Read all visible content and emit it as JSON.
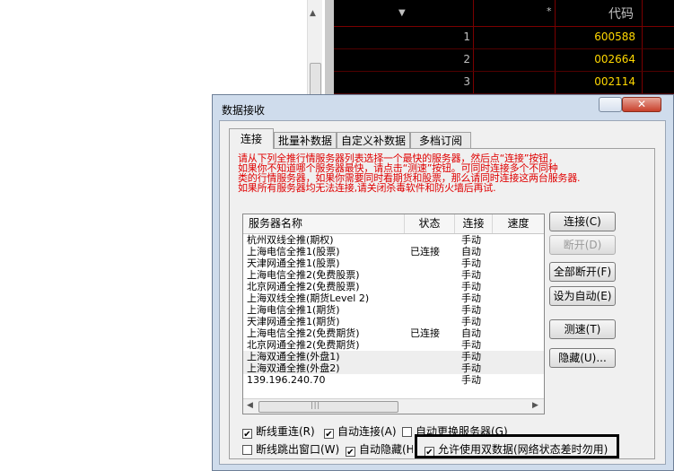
{
  "grid": {
    "header": {
      "star": "*",
      "code": "代码"
    },
    "rows": [
      {
        "num": "1",
        "code": "600588"
      },
      {
        "num": "2",
        "code": "002664"
      },
      {
        "num": "3",
        "code": "002114"
      }
    ]
  },
  "dialog": {
    "title": "数据接收",
    "close_label": "✕",
    "tabs": [
      "连接",
      "批量补数据",
      "自定义补数据",
      "多档订阅"
    ],
    "instruction_lines": [
      "请从下列全推行情服务器列表选择一个最快的服务器，然后点“连接”按钮，",
      "如果你不知道哪个服务器最快，请点击“测速”按钮。可同时连接多个不同种",
      "类的行情服务器，如果你需要同时看期货和股票，那么请同时连接这两台服务器.",
      "如果所有服务器均无法连接,请关闭杀毒软件和防火墙后再试."
    ],
    "columns": [
      "服务器名称",
      "状态",
      "连接",
      "速度"
    ],
    "servers": [
      {
        "name": "杭州双线全推(期权)",
        "status": "",
        "conn": "手动"
      },
      {
        "name": "上海电信全推1(股票)",
        "status": "已连接",
        "conn": "自动"
      },
      {
        "name": "天津网通全推1(股票)",
        "status": "",
        "conn": "手动"
      },
      {
        "name": "上海电信全推2(免费股票)",
        "status": "",
        "conn": "手动"
      },
      {
        "name": "北京网通全推2(免费股票)",
        "status": "",
        "conn": "手动"
      },
      {
        "name": "上海双线全推(期货Level 2)",
        "status": "",
        "conn": "手动"
      },
      {
        "name": "上海电信全推1(期货)",
        "status": "",
        "conn": "手动"
      },
      {
        "name": "天津网通全推1(期货)",
        "status": "",
        "conn": "手动"
      },
      {
        "name": "上海电信全推2(免费期货)",
        "status": "已连接",
        "conn": "自动"
      },
      {
        "name": "北京网通全推2(免费期货)",
        "status": "",
        "conn": "手动"
      },
      {
        "name": "上海双通全推(外盘1)",
        "status": "",
        "conn": "手动"
      },
      {
        "name": "上海双通全推(外盘2)",
        "status": "",
        "conn": "手动"
      },
      {
        "name": "139.196.240.70",
        "status": "",
        "conn": "手动"
      }
    ],
    "buttons": {
      "connect": "连接(C)",
      "disconnect": "断开(D)",
      "disconnect_all": "全部断开(F)",
      "set_auto": "设为自动(E)",
      "speed_test": "测速(T)",
      "hide": "隐藏(U)..."
    },
    "options": [
      {
        "label": "断线重连(R)",
        "checked": true
      },
      {
        "label": "自动连接(A)",
        "checked": true
      },
      {
        "label": "自动更换服务器(G)",
        "checked": false
      },
      {
        "label": "断线跳出窗口(W)",
        "checked": false
      },
      {
        "label": "自动隐藏(H)",
        "checked": true
      },
      {
        "label": "允许使用双数据(网络状态差时勿用)",
        "checked": true
      }
    ]
  }
}
